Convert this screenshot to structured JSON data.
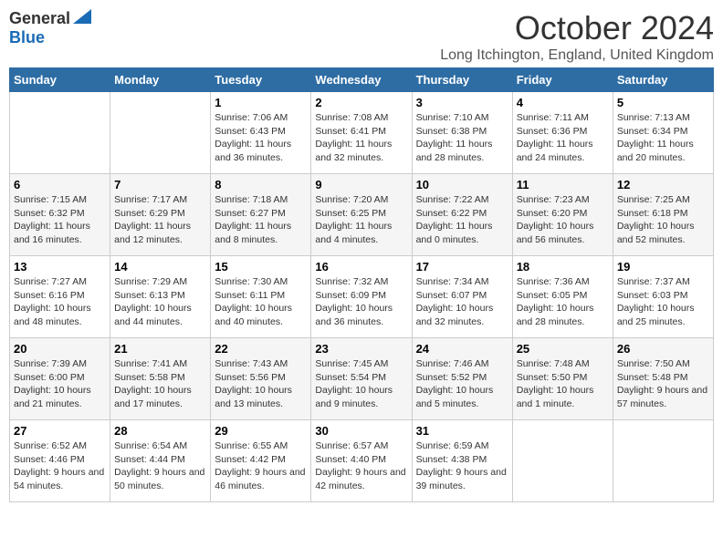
{
  "logo": {
    "general": "General",
    "blue": "Blue"
  },
  "title": "October 2024",
  "location": "Long Itchington, England, United Kingdom",
  "weekdays": [
    "Sunday",
    "Monday",
    "Tuesday",
    "Wednesday",
    "Thursday",
    "Friday",
    "Saturday"
  ],
  "weeks": [
    [
      {
        "day": "",
        "sunrise": "",
        "sunset": "",
        "daylight": ""
      },
      {
        "day": "",
        "sunrise": "",
        "sunset": "",
        "daylight": ""
      },
      {
        "day": "1",
        "sunrise": "Sunrise: 7:06 AM",
        "sunset": "Sunset: 6:43 PM",
        "daylight": "Daylight: 11 hours and 36 minutes."
      },
      {
        "day": "2",
        "sunrise": "Sunrise: 7:08 AM",
        "sunset": "Sunset: 6:41 PM",
        "daylight": "Daylight: 11 hours and 32 minutes."
      },
      {
        "day": "3",
        "sunrise": "Sunrise: 7:10 AM",
        "sunset": "Sunset: 6:38 PM",
        "daylight": "Daylight: 11 hours and 28 minutes."
      },
      {
        "day": "4",
        "sunrise": "Sunrise: 7:11 AM",
        "sunset": "Sunset: 6:36 PM",
        "daylight": "Daylight: 11 hours and 24 minutes."
      },
      {
        "day": "5",
        "sunrise": "Sunrise: 7:13 AM",
        "sunset": "Sunset: 6:34 PM",
        "daylight": "Daylight: 11 hours and 20 minutes."
      }
    ],
    [
      {
        "day": "6",
        "sunrise": "Sunrise: 7:15 AM",
        "sunset": "Sunset: 6:32 PM",
        "daylight": "Daylight: 11 hours and 16 minutes."
      },
      {
        "day": "7",
        "sunrise": "Sunrise: 7:17 AM",
        "sunset": "Sunset: 6:29 PM",
        "daylight": "Daylight: 11 hours and 12 minutes."
      },
      {
        "day": "8",
        "sunrise": "Sunrise: 7:18 AM",
        "sunset": "Sunset: 6:27 PM",
        "daylight": "Daylight: 11 hours and 8 minutes."
      },
      {
        "day": "9",
        "sunrise": "Sunrise: 7:20 AM",
        "sunset": "Sunset: 6:25 PM",
        "daylight": "Daylight: 11 hours and 4 minutes."
      },
      {
        "day": "10",
        "sunrise": "Sunrise: 7:22 AM",
        "sunset": "Sunset: 6:22 PM",
        "daylight": "Daylight: 11 hours and 0 minutes."
      },
      {
        "day": "11",
        "sunrise": "Sunrise: 7:23 AM",
        "sunset": "Sunset: 6:20 PM",
        "daylight": "Daylight: 10 hours and 56 minutes."
      },
      {
        "day": "12",
        "sunrise": "Sunrise: 7:25 AM",
        "sunset": "Sunset: 6:18 PM",
        "daylight": "Daylight: 10 hours and 52 minutes."
      }
    ],
    [
      {
        "day": "13",
        "sunrise": "Sunrise: 7:27 AM",
        "sunset": "Sunset: 6:16 PM",
        "daylight": "Daylight: 10 hours and 48 minutes."
      },
      {
        "day": "14",
        "sunrise": "Sunrise: 7:29 AM",
        "sunset": "Sunset: 6:13 PM",
        "daylight": "Daylight: 10 hours and 44 minutes."
      },
      {
        "day": "15",
        "sunrise": "Sunrise: 7:30 AM",
        "sunset": "Sunset: 6:11 PM",
        "daylight": "Daylight: 10 hours and 40 minutes."
      },
      {
        "day": "16",
        "sunrise": "Sunrise: 7:32 AM",
        "sunset": "Sunset: 6:09 PM",
        "daylight": "Daylight: 10 hours and 36 minutes."
      },
      {
        "day": "17",
        "sunrise": "Sunrise: 7:34 AM",
        "sunset": "Sunset: 6:07 PM",
        "daylight": "Daylight: 10 hours and 32 minutes."
      },
      {
        "day": "18",
        "sunrise": "Sunrise: 7:36 AM",
        "sunset": "Sunset: 6:05 PM",
        "daylight": "Daylight: 10 hours and 28 minutes."
      },
      {
        "day": "19",
        "sunrise": "Sunrise: 7:37 AM",
        "sunset": "Sunset: 6:03 PM",
        "daylight": "Daylight: 10 hours and 25 minutes."
      }
    ],
    [
      {
        "day": "20",
        "sunrise": "Sunrise: 7:39 AM",
        "sunset": "Sunset: 6:00 PM",
        "daylight": "Daylight: 10 hours and 21 minutes."
      },
      {
        "day": "21",
        "sunrise": "Sunrise: 7:41 AM",
        "sunset": "Sunset: 5:58 PM",
        "daylight": "Daylight: 10 hours and 17 minutes."
      },
      {
        "day": "22",
        "sunrise": "Sunrise: 7:43 AM",
        "sunset": "Sunset: 5:56 PM",
        "daylight": "Daylight: 10 hours and 13 minutes."
      },
      {
        "day": "23",
        "sunrise": "Sunrise: 7:45 AM",
        "sunset": "Sunset: 5:54 PM",
        "daylight": "Daylight: 10 hours and 9 minutes."
      },
      {
        "day": "24",
        "sunrise": "Sunrise: 7:46 AM",
        "sunset": "Sunset: 5:52 PM",
        "daylight": "Daylight: 10 hours and 5 minutes."
      },
      {
        "day": "25",
        "sunrise": "Sunrise: 7:48 AM",
        "sunset": "Sunset: 5:50 PM",
        "daylight": "Daylight: 10 hours and 1 minute."
      },
      {
        "day": "26",
        "sunrise": "Sunrise: 7:50 AM",
        "sunset": "Sunset: 5:48 PM",
        "daylight": "Daylight: 9 hours and 57 minutes."
      }
    ],
    [
      {
        "day": "27",
        "sunrise": "Sunrise: 6:52 AM",
        "sunset": "Sunset: 4:46 PM",
        "daylight": "Daylight: 9 hours and 54 minutes."
      },
      {
        "day": "28",
        "sunrise": "Sunrise: 6:54 AM",
        "sunset": "Sunset: 4:44 PM",
        "daylight": "Daylight: 9 hours and 50 minutes."
      },
      {
        "day": "29",
        "sunrise": "Sunrise: 6:55 AM",
        "sunset": "Sunset: 4:42 PM",
        "daylight": "Daylight: 9 hours and 46 minutes."
      },
      {
        "day": "30",
        "sunrise": "Sunrise: 6:57 AM",
        "sunset": "Sunset: 4:40 PM",
        "daylight": "Daylight: 9 hours and 42 minutes."
      },
      {
        "day": "31",
        "sunrise": "Sunrise: 6:59 AM",
        "sunset": "Sunset: 4:38 PM",
        "daylight": "Daylight: 9 hours and 39 minutes."
      },
      {
        "day": "",
        "sunrise": "",
        "sunset": "",
        "daylight": ""
      },
      {
        "day": "",
        "sunrise": "",
        "sunset": "",
        "daylight": ""
      }
    ]
  ]
}
